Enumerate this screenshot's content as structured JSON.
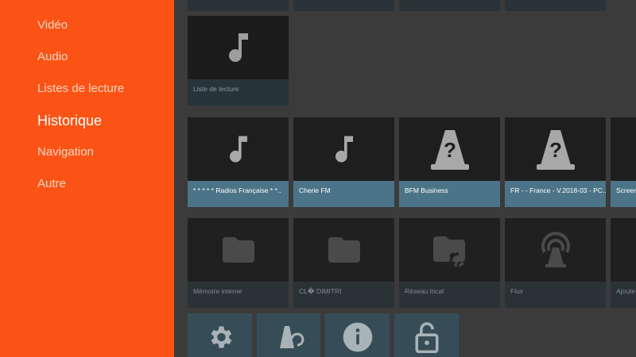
{
  "sidebar": {
    "items": [
      {
        "label": "Vidéo"
      },
      {
        "label": "Audio"
      },
      {
        "label": "Listes de lecture"
      },
      {
        "label": "Historique"
      },
      {
        "label": "Navigation"
      },
      {
        "label": "Autre"
      }
    ],
    "selected": "Historique",
    "background": "#fb5315"
  },
  "playlists": {
    "cards": [
      {
        "caption": "Liste de lecture",
        "icon": "music-note-icon"
      }
    ]
  },
  "history": {
    "cards": [
      {
        "caption": "* * * * * Radios Française * *..",
        "icon": "music-note-icon"
      },
      {
        "caption": "Cherie FM",
        "icon": "music-note-icon"
      },
      {
        "caption": "BFM Business",
        "icon": "vlc-unknown-icon"
      },
      {
        "caption": "FR - - France - V.2018-03 - PC...",
        "icon": "vlc-unknown-icon"
      },
      {
        "caption": "Screen",
        "icon": ""
      }
    ]
  },
  "browse": {
    "cards": [
      {
        "caption": "Mémoire interne",
        "icon": "folder-icon"
      },
      {
        "caption": "CL� DIMITRI",
        "icon": "folder-icon"
      },
      {
        "caption": "Réseau local",
        "icon": "network-folder-icon"
      },
      {
        "caption": "Flux",
        "icon": "stream-antenna-icon"
      },
      {
        "caption": "Ajoute",
        "icon": ""
      }
    ]
  },
  "other": {
    "cards": [
      {
        "icon": "settings-gear-icon"
      },
      {
        "icon": "vlc-refresh-icon"
      },
      {
        "icon": "info-icon"
      },
      {
        "icon": "unlock-icon"
      }
    ]
  },
  "colors": {
    "accent": "#fb5315",
    "media_caption": "#4c7488",
    "caption_dark": "#283238"
  }
}
